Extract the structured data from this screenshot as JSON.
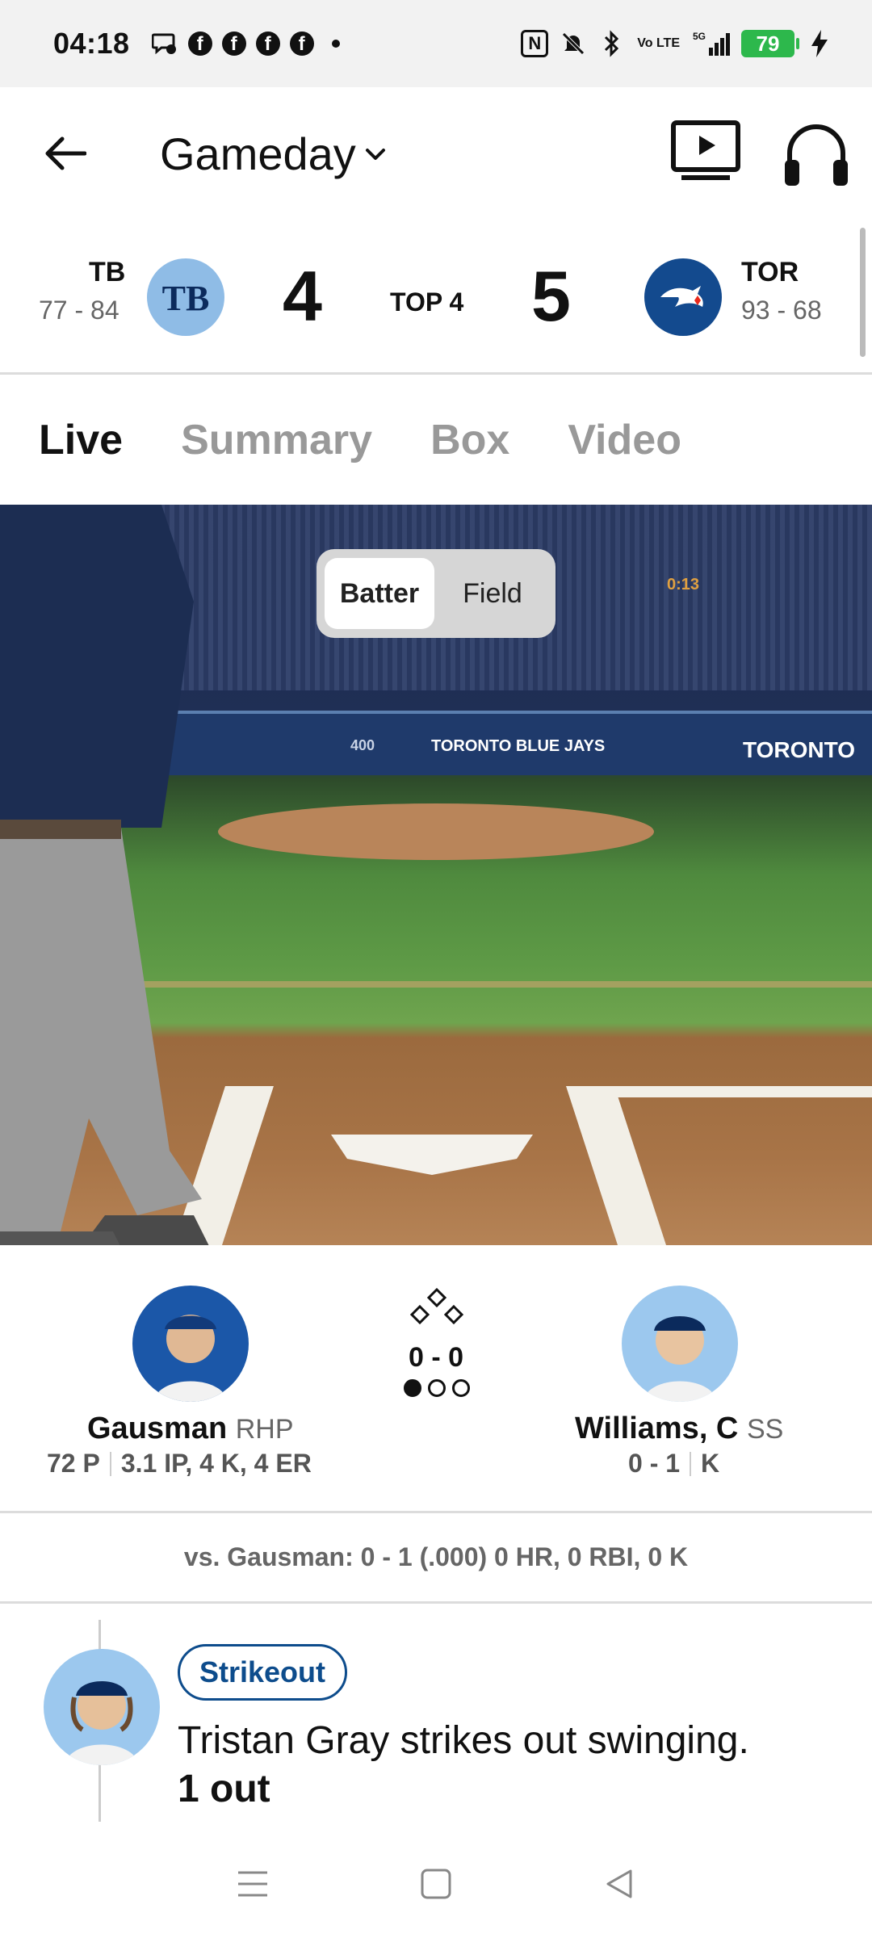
{
  "status_bar": {
    "time": "04:18",
    "notification_icons": [
      "chat-icon",
      "facebook-icon",
      "facebook-icon",
      "facebook-icon",
      "facebook-icon",
      "dot"
    ],
    "nfc_label": "N",
    "volte_label": "Vo LTE",
    "network_label": "5G",
    "battery_level": "79"
  },
  "header": {
    "title": "Gameday",
    "icons": [
      "back-arrow-icon",
      "chevron-down-icon",
      "tv-play-icon",
      "headphones-icon"
    ]
  },
  "scoreboard": {
    "away": {
      "abbr": "TB",
      "record": "77 - 84",
      "score": "4",
      "logo_text": "TB",
      "color": "#8fbce6"
    },
    "home": {
      "abbr": "TOR",
      "record": "93 - 68",
      "score": "5",
      "logo_text": "TOR",
      "color": "#134a8e"
    },
    "inning": "TOP 4"
  },
  "tabs": [
    {
      "label": "Live",
      "active": true
    },
    {
      "label": "Summary",
      "active": false
    },
    {
      "label": "Box",
      "active": false
    },
    {
      "label": "Video",
      "active": false
    }
  ],
  "field_view": {
    "toggle": [
      {
        "label": "Batter",
        "active": true
      },
      {
        "label": "Field",
        "active": false
      }
    ],
    "wall_texts": [
      "400",
      "TORONTO BLUE JAYS",
      "TORONTO"
    ],
    "scoreboard_time": "0:13"
  },
  "matchup": {
    "pitcher": {
      "name": "Gausman",
      "position": "RHP",
      "stat1": "72 P",
      "stat2": "3.1 IP, 4 K, 4 ER"
    },
    "batter": {
      "name": "Williams, C",
      "position": "SS",
      "stat1": "0 - 1",
      "stat2": "K"
    },
    "count": "0 - 0",
    "outs": 1
  },
  "vs_line": "vs. Gausman: 0 - 1 (.000) 0 HR, 0 RBI, 0 K",
  "play": {
    "badge": "Strikeout",
    "text": "Tristan Gray strikes out swinging.",
    "outs_text": "1 out"
  },
  "nav": [
    "menu-icon",
    "home-square-icon",
    "back-triangle-icon"
  ]
}
